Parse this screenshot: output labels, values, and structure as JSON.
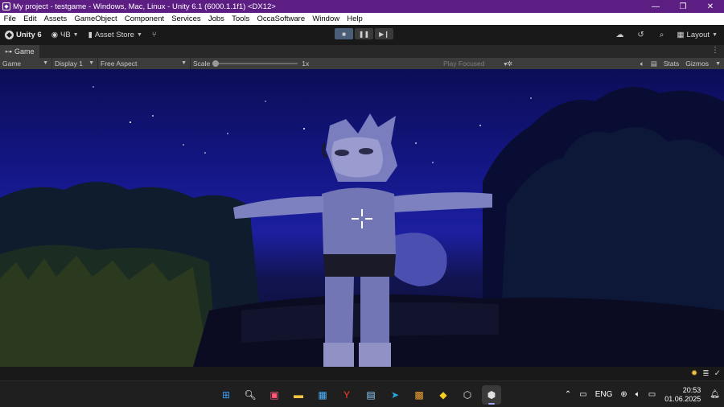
{
  "window": {
    "title": "My project - testgame - Windows, Mac, Linux - Unity 6.1 (6000.1.1f1) <DX12>",
    "controls": {
      "minimize": "—",
      "maximize": "❐",
      "close": "✕"
    }
  },
  "menu": {
    "items": [
      "File",
      "Edit",
      "Assets",
      "GameObject",
      "Component",
      "Services",
      "Jobs",
      "Tools",
      "OccaSoftware",
      "Window",
      "Help"
    ]
  },
  "toolbar": {
    "unity_label": "Unity 6",
    "account_label": "ЧВ",
    "asset_store_label": "Asset Store",
    "layout_label": "Layout"
  },
  "game_view": {
    "tab_label": "Game",
    "mode": "Game",
    "display": "Display 1",
    "aspect": "Free Aspect",
    "scale_label": "Scale",
    "scale_value": "1x",
    "scale_level": 0,
    "play_focused": "Play Focused",
    "stats_label": "Stats",
    "gizmos_label": "Gizmos"
  },
  "taskbar": {
    "apps": [
      {
        "name": "windows-start",
        "glyph": "⊞",
        "color": "#3aa0ff"
      },
      {
        "name": "search",
        "glyph": "🔍︎",
        "color": "#ffffff"
      },
      {
        "name": "store-pre",
        "glyph": "▣",
        "color": "#ff5a7a"
      },
      {
        "name": "file-explorer",
        "glyph": "▬",
        "color": "#f4c542"
      },
      {
        "name": "microsoft-store",
        "glyph": "▦",
        "color": "#4fb4ff"
      },
      {
        "name": "yandex-browser",
        "glyph": "Y",
        "color": "#ff3b30"
      },
      {
        "name": "xm-app",
        "glyph": "▤",
        "color": "#8fd0ff"
      },
      {
        "name": "telegram",
        "glyph": "➤",
        "color": "#2aa9e0"
      },
      {
        "name": "app-tile",
        "glyph": "▩",
        "color": "#f0a030"
      },
      {
        "name": "duck-app",
        "glyph": "◆",
        "color": "#f5d020"
      },
      {
        "name": "unity-hub",
        "glyph": "⬡",
        "color": "#e0e0e0"
      },
      {
        "name": "unity-editor",
        "glyph": "⬢",
        "color": "#e0e0e0"
      }
    ],
    "language": "ENG",
    "time": "20:53",
    "date": "01.06.2025"
  },
  "colors": {
    "titlebar": "#5c1e82",
    "sky_top": "#0c0d57",
    "sky_mid": "#1c1fa0",
    "ground": "#0b0c2a"
  }
}
